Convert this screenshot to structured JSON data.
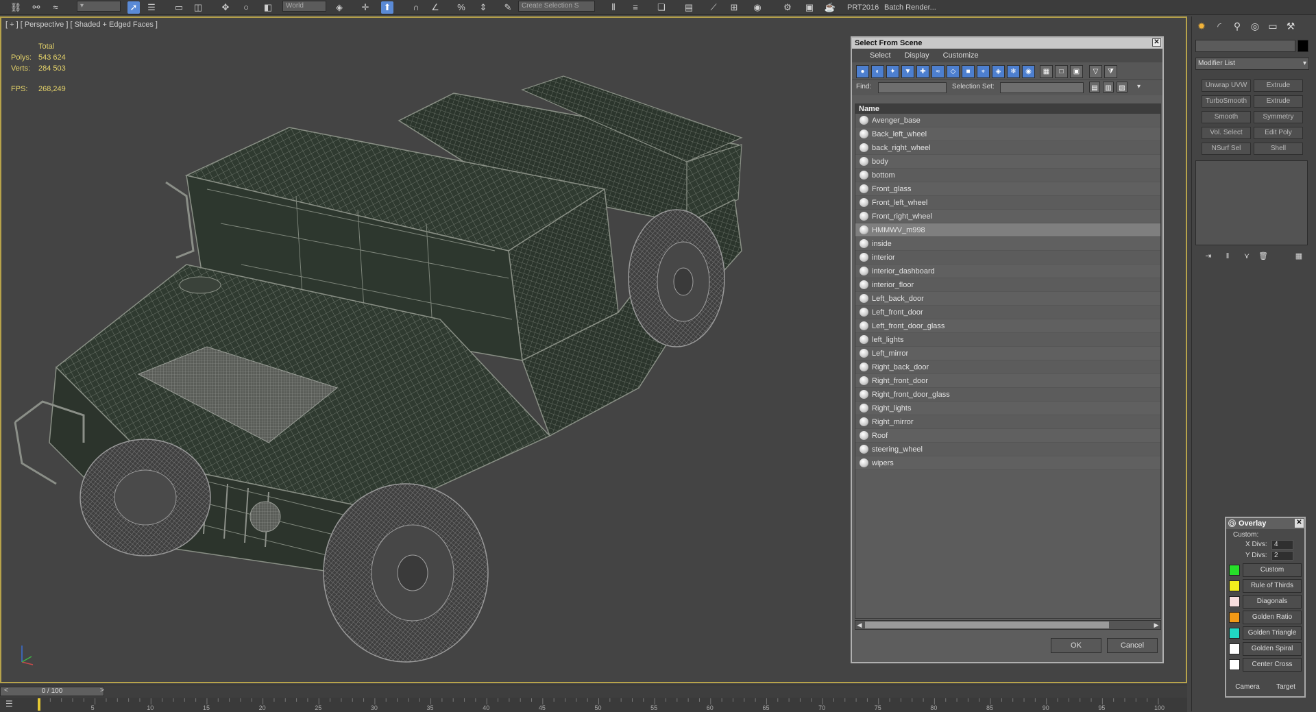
{
  "toolbar": {
    "coord_dropdown": "World",
    "selection_set": "Create Selection S",
    "prt_label": "PRT2016",
    "batch_render": "Batch Render..."
  },
  "viewport": {
    "label": "[ + ] [ Perspective ] [ Shaded + Edged Faces ]",
    "stats": {
      "total_label": "Total",
      "polys_label": "Polys:",
      "polys": "543 624",
      "verts_label": "Verts:",
      "verts": "284 503",
      "fps_label": "FPS:",
      "fps": "268,249"
    }
  },
  "dialog": {
    "title": "Select From Scene",
    "menu": [
      "Select",
      "Display",
      "Customize"
    ],
    "find_label": "Find:",
    "selection_set_label": "Selection Set:",
    "column_header": "Name",
    "items": [
      "Avenger_base",
      "Back_left_wheel",
      "back_right_wheel",
      "body",
      "bottom",
      "Front_glass",
      "Front_left_wheel",
      "Front_right_wheel",
      "HMMWV_m998",
      "inside",
      "interior",
      "interior_dashboard",
      "interior_floor",
      "Left_back_door",
      "Left_front_door",
      "Left_front_door_glass",
      "left_lights",
      "Left_mirror",
      "Right_back_door",
      "Right_front_door",
      "Right_front_door_glass",
      "Right_lights",
      "Right_mirror",
      "Roof",
      "steering_wheel",
      "wipers"
    ],
    "selected_item": "HMMWV_m998",
    "ok_label": "OK",
    "cancel_label": "Cancel"
  },
  "command_panel": {
    "modifier_list": "Modifier List",
    "buttons": [
      "Unwrap UVW",
      "Extrude",
      "TurboSmooth",
      "Extrude",
      "Smooth",
      "Symmetry",
      "Vol. Select",
      "Edit Poly",
      "NSurf Sel",
      "Shell"
    ]
  },
  "overlay": {
    "title": "Overlay",
    "custom_label": "Custom:",
    "xdivs_label": "X Divs:",
    "xdivs": "4",
    "ydivs_label": "Y Divs:",
    "ydivs": "2",
    "items": [
      {
        "label": "Custom",
        "color": "#27e02a"
      },
      {
        "label": "Rule of Thirds",
        "color": "#f2ee1d"
      },
      {
        "label": "Diagonals",
        "color": "#f7dede"
      },
      {
        "label": "Golden Ratio",
        "color": "#f29a16"
      },
      {
        "label": "Golden Triangle",
        "color": "#21d8c4"
      },
      {
        "label": "Golden Spiral",
        "color": "#ffffff"
      },
      {
        "label": "Center Cross",
        "color": "#ffffff"
      }
    ],
    "camera_label": "Camera",
    "target_label": "Target"
  },
  "timeline": {
    "frame": "0 / 100",
    "ticks": [
      "5",
      "10",
      "15",
      "20",
      "25",
      "30",
      "35",
      "40",
      "45",
      "50",
      "55",
      "60",
      "65",
      "70",
      "75",
      "80",
      "85",
      "90",
      "95",
      "100"
    ]
  }
}
